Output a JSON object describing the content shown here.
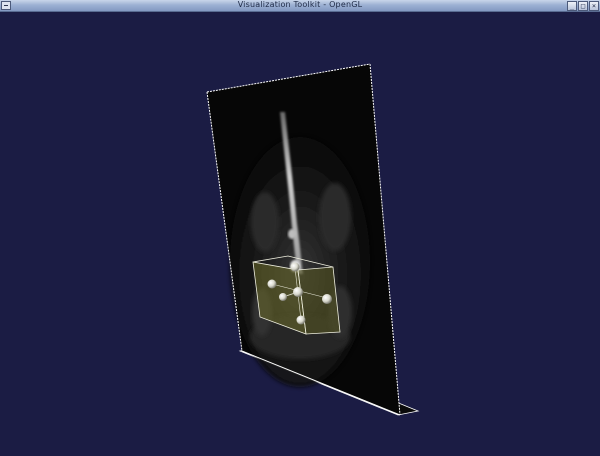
{
  "window": {
    "title": "Visualization Toolkit - OpenGL",
    "icon": "vtk-window-icon",
    "buttons": [
      {
        "name": "minimize-button",
        "icon": "minimize-icon",
        "glyph": "_"
      },
      {
        "name": "maximize-button",
        "icon": "maximize-icon",
        "glyph": "□"
      },
      {
        "name": "close-button",
        "icon": "close-icon",
        "glyph": "×"
      }
    ]
  },
  "scene": {
    "background_color": "#1b1c44",
    "plane_outline_color": "#ffffff",
    "widget_box_color": "#6b6b2a",
    "handle_color": "#e8e8e0",
    "content": "MRI slice plane with box widget"
  }
}
